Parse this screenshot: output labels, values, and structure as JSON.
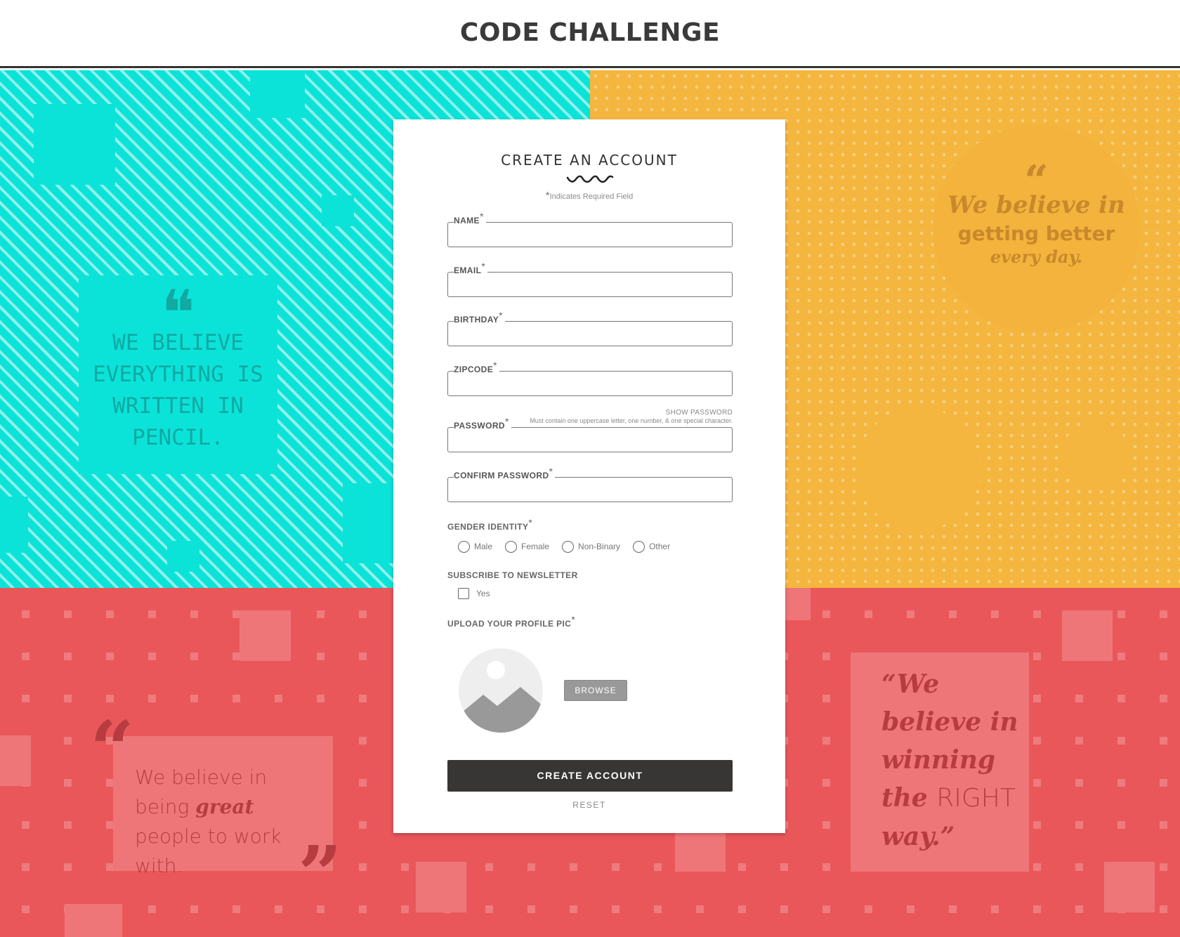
{
  "header": {
    "title": "CODE CHALLENGE"
  },
  "quotes": {
    "teal": {
      "mark": "❝",
      "text": "WE BELIEVE EVERYTHING IS WRITTEN IN PENCIL."
    },
    "yellow": {
      "mark": "“",
      "line1": "We believe in",
      "line2": "getting better",
      "line3": "every day."
    },
    "red_left": {
      "part1": "We believe in being ",
      "emph": "great",
      "part2": " people to work with.",
      "open_mark": "“",
      "close_mark": "”"
    },
    "red_right": {
      "part1": "“We believe in winning the ",
      "plain": "RIGHT",
      "part2": " way.”"
    }
  },
  "form": {
    "title": "CREATE AN ACCOUNT",
    "required_note_star": "*",
    "required_note": "Indicates Required Field",
    "fields": {
      "name": {
        "label": "NAME",
        "value": ""
      },
      "email": {
        "label": "EMAIL",
        "value": ""
      },
      "birthday": {
        "label": "BIRTHDAY",
        "value": ""
      },
      "zipcode": {
        "label": "ZIPCODE",
        "value": ""
      },
      "password": {
        "label": "PASSWORD",
        "value": ""
      },
      "confirm_password": {
        "label": "CONFIRM PASSWORD",
        "value": ""
      }
    },
    "required_marker": "*",
    "show_password": "SHOW PASSWORD",
    "password_hint": "Must contain one uppercase letter, one number, & one special character.",
    "gender": {
      "label": "GENDER IDENTITY",
      "options": [
        "Male",
        "Female",
        "Non-Binary",
        "Other"
      ]
    },
    "newsletter": {
      "label": "SUBSCRIBE TO NEWSLETTER",
      "option": "Yes"
    },
    "upload": {
      "label": "UPLOAD YOUR PROFILE PIC",
      "browse": "BROWSE"
    },
    "submit": "CREATE ACCOUNT",
    "reset": "RESET"
  },
  "colors": {
    "teal": "#0be3d9",
    "yellow": "#f4b63e",
    "red": "#e9575a",
    "pink": "#ef7678",
    "dark": "#373635"
  }
}
